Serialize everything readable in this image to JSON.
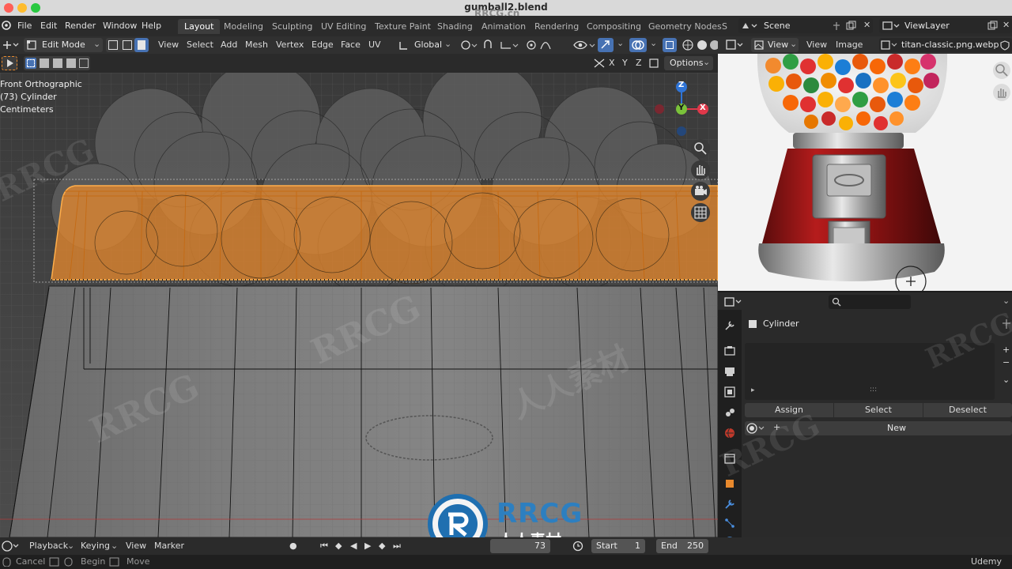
{
  "window": {
    "title": "gumball2.blend",
    "watermark_url": "RRCG.cn"
  },
  "menu": [
    "File",
    "Edit",
    "Render",
    "Window",
    "Help"
  ],
  "workspaces": {
    "active": "Layout",
    "tabs": [
      "Layout",
      "Modeling",
      "Sculpting",
      "UV Editing",
      "Texture Paint",
      "Shading",
      "Animation",
      "Rendering",
      "Compositing",
      "Geometry Nodes",
      "S"
    ]
  },
  "scene": {
    "scene_name": "Scene",
    "view_layer": "ViewLayer"
  },
  "viewport_header": {
    "mode": "Edit Mode",
    "menus": [
      "View",
      "Select",
      "Add",
      "Mesh",
      "Vertex",
      "Edge",
      "Face",
      "UV"
    ],
    "transform_orientation": "Global",
    "axes": [
      "X",
      "Y",
      "Z"
    ],
    "options_label": "Options"
  },
  "viewport": {
    "view_name": "Front Orthographic",
    "object_info": "(73) Cylinder",
    "units": "Centimeters",
    "gizmo": {
      "z": "Z",
      "y": "Y",
      "x": "X"
    }
  },
  "image_editor": {
    "view_label": "View",
    "menu_view": "View",
    "menu_image": "Image",
    "image_name": "titan-classic.png.webp"
  },
  "properties": {
    "object_name": "Cylinder",
    "assign_label": "Assign",
    "select_label": "Select",
    "deselect_label": "Deselect",
    "new_label": "New"
  },
  "timeline": {
    "playback_label": "Playback",
    "keying_label": "Keying",
    "view_label": "View",
    "marker_label": "Marker",
    "current_frame": "73",
    "start_label": "Start",
    "start_value": "1",
    "end_label": "End",
    "end_value": "250"
  },
  "statusbar": {
    "cancel": "Cancel",
    "begin": "Begin",
    "move": "Move",
    "brand": "Udemy"
  },
  "overlay_logo": {
    "name": "RRCG",
    "subtitle": "人人素材"
  },
  "colors": {
    "selection_orange": "#e8892d",
    "active_tab": "#3d3d3d",
    "gizmo_x": "#e0384a",
    "gizmo_y": "#7ac23a",
    "gizmo_z": "#2f74d6"
  }
}
